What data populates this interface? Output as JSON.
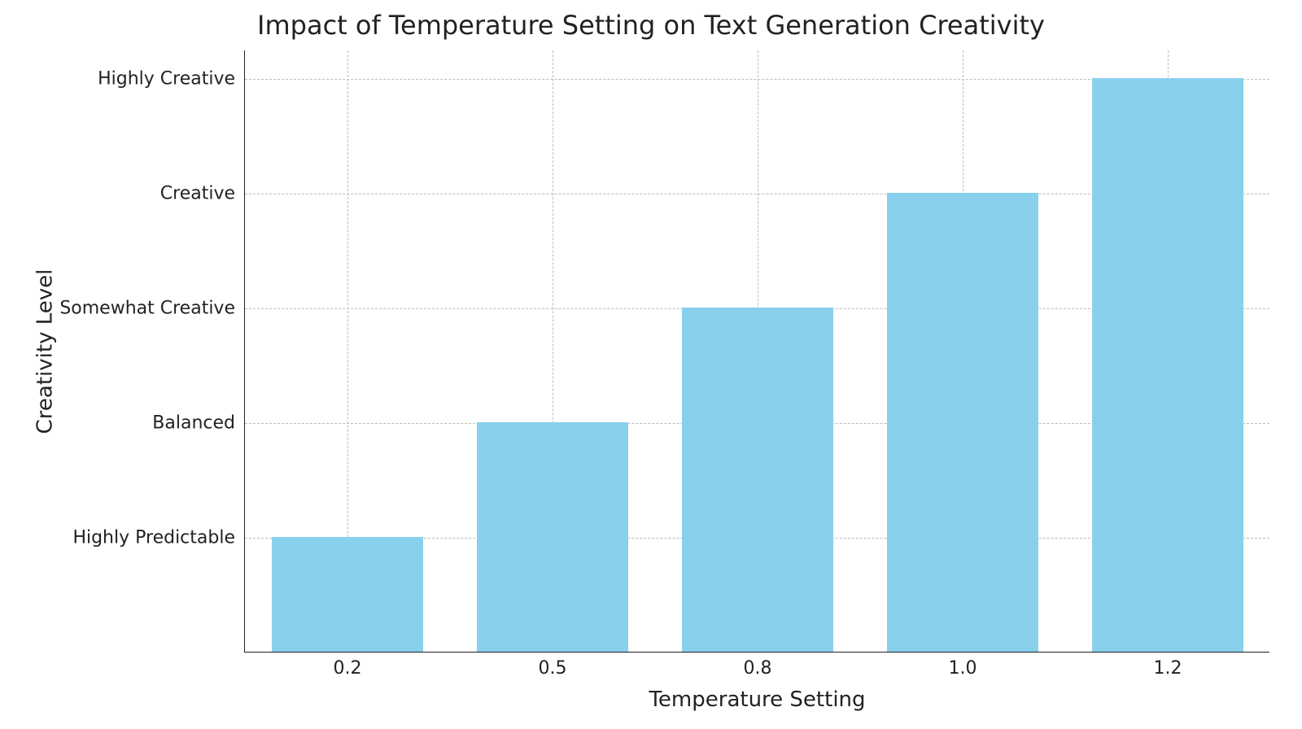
{
  "chart_data": {
    "type": "bar",
    "title": "Impact of Temperature Setting on Text Generation Creativity",
    "xlabel": "Temperature Setting",
    "ylabel": "Creativity Level",
    "categories": [
      "0.2",
      "0.5",
      "0.8",
      "1.0",
      "1.2"
    ],
    "values": [
      1,
      2,
      3,
      4,
      5
    ],
    "y_tick_labels": [
      "Highly Predictable",
      "Balanced",
      "Somewhat Creative",
      "Creative",
      "Highly Creative"
    ],
    "y_tick_values": [
      1,
      2,
      3,
      4,
      5
    ],
    "ylim": [
      0,
      5.25
    ],
    "grid": true,
    "bar_color": "#89d0ec"
  }
}
